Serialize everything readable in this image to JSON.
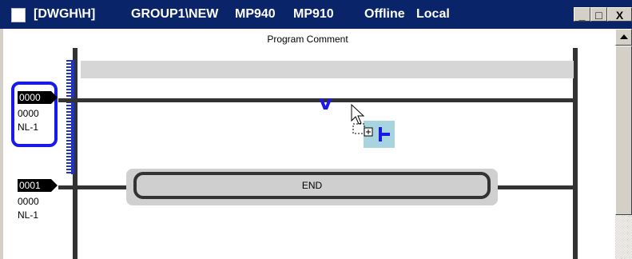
{
  "window": {
    "title_parts": [
      "[DWGH\\H]",
      "GROUP1\\NEW",
      "MP940",
      "MP910",
      "Offline",
      "Local"
    ],
    "controls": {
      "minimize": "_",
      "restore": "□",
      "close": "X"
    }
  },
  "editor": {
    "program_comment": "Program Comment",
    "rungs": [
      {
        "step": "0000",
        "line2": "0000",
        "line3": "NL-1"
      },
      {
        "step": "0001",
        "line2": "0000",
        "line3": "NL-1"
      }
    ],
    "end_instruction": "END",
    "insert_marker": "v"
  },
  "colors": {
    "titlebar": "#0a246a",
    "selection": "#1a1ae6",
    "rail": "#333333",
    "end_block": "#d0d0d0",
    "contact_highlight": "#a8d4e0"
  },
  "icons": [
    "system-menu-icon",
    "drag-copy-cursor-icon",
    "contact-icon",
    "scroll-up-arrow-icon"
  ]
}
